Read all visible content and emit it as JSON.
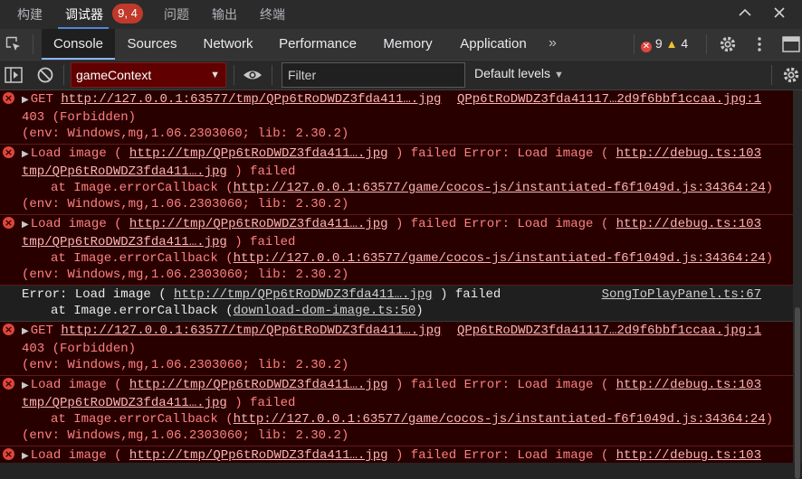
{
  "top_tabs": [
    "构建",
    "调试器",
    "问题",
    "输出",
    "终端"
  ],
  "debugger_badge": "9, 4",
  "devtools_tabs": [
    "Console",
    "Sources",
    "Network",
    "Performance",
    "Memory",
    "Application"
  ],
  "error_count": "9",
  "warning_count": "4",
  "context_select": "gameContext",
  "filter_placeholder": "Filter",
  "levels_label": "Default levels",
  "log": {
    "e1": {
      "l1a": "GET ",
      "l1url": "http://127.0.0.1:63577/tmp/QPp6tRoDWDZ3fda411….jpg",
      "src": "QPp6tRoDWDZ3fda41117…2d9f6bbf1ccaa.jpg:1",
      "l2": "403 (Forbidden)",
      "l3": "(env: Windows,mg,1.06.2303060; lib: 2.30.2)"
    },
    "e2": {
      "l1a": "Load image ( ",
      "l1url": "http://tmp/QPp6tRoDWDZ3fda411….jpg",
      "l1b": " ) failed Error: Load image ( ",
      "l1url2": "http://",
      "src": "debug.ts:103",
      "l2url": "tmp/QPp6tRoDWDZ3fda411….jpg",
      "l2b": " ) failed",
      "l3a": "at Image.errorCallback (",
      "l3url": "http://127.0.0.1:63577/game/cocos-js/instantiated-f6f1049d.js:34364:24",
      "l3b": ")",
      "l4": "(env: Windows,mg,1.06.2303060; lib: 2.30.2)"
    },
    "e3": {
      "l1a": "Load image ( ",
      "l1url": "http://tmp/QPp6tRoDWDZ3fda411….jpg",
      "l1b": " ) failed Error: Load image ( ",
      "l1url2": "http://",
      "src": "debug.ts:103",
      "l2url": "tmp/QPp6tRoDWDZ3fda411….jpg",
      "l2b": " ) failed",
      "l3a": "at Image.errorCallback (",
      "l3url": "http://127.0.0.1:63577/game/cocos-js/instantiated-f6f1049d.js:34364:24",
      "l3b": ")",
      "l4": "(env: Windows,mg,1.06.2303060; lib: 2.30.2)"
    },
    "p4": {
      "l1a": "Error: Load image ( ",
      "l1url": "http://tmp/QPp6tRoDWDZ3fda411….jpg",
      "l1b": " ) failed",
      "src": "SongToPlayPanel.ts:67",
      "l2a": "at Image.errorCallback (",
      "l2url": "download-dom-image.ts:50",
      "l2b": ")"
    },
    "e5": {
      "l1a": "GET ",
      "l1url": "http://127.0.0.1:63577/tmp/QPp6tRoDWDZ3fda411….jpg",
      "src": "QPp6tRoDWDZ3fda41117…2d9f6bbf1ccaa.jpg:1",
      "l2": "403 (Forbidden)",
      "l3": "(env: Windows,mg,1.06.2303060; lib: 2.30.2)"
    },
    "e6": {
      "l1a": "Load image ( ",
      "l1url": "http://tmp/QPp6tRoDWDZ3fda411….jpg",
      "l1b": " ) failed Error: Load image ( ",
      "l1url2": "http://",
      "src": "debug.ts:103",
      "l2url": "tmp/QPp6tRoDWDZ3fda411….jpg",
      "l2b": " ) failed",
      "l3a": "at Image.errorCallback (",
      "l3url": "http://127.0.0.1:63577/game/cocos-js/instantiated-f6f1049d.js:34364:24",
      "l3b": ")",
      "l4": "(env: Windows,mg,1.06.2303060; lib: 2.30.2)"
    },
    "e7": {
      "l1a": "Load image ( ",
      "l1url": "http://tmp/QPp6tRoDWDZ3fda411….jpg",
      "l1b": " ) failed Error: Load image ( ",
      "l1url2": "http://",
      "src": "debug.ts:103"
    }
  }
}
